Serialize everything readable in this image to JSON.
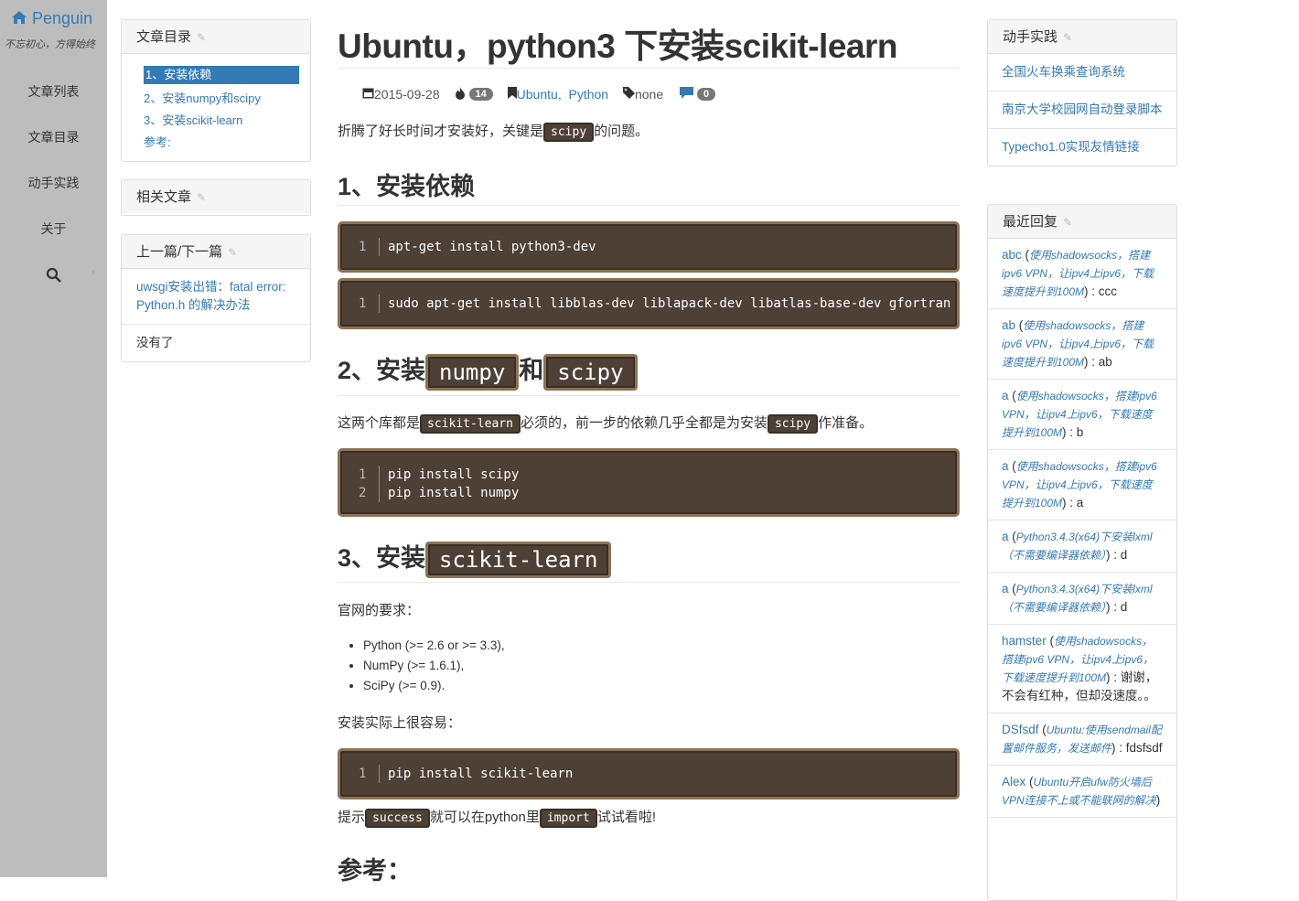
{
  "nav": {
    "brand": "Penguin",
    "motto": "不忘初心，方得始终",
    "items": [
      "文章列表",
      "文章目录",
      "动手实践",
      "关于"
    ]
  },
  "toc_panel": {
    "title": "文章目录",
    "items": [
      "1、安装依赖",
      "2、安装numpy和scipy",
      "3、安装scikit-learn",
      "参考:"
    ]
  },
  "related_panel": {
    "title": "相关文章"
  },
  "prevnext_panel": {
    "title": "上一篇/下一篇",
    "prev": "uwsgi安装出错：fatal error: Python.h 的解决办法",
    "next": "没有了"
  },
  "article": {
    "title": "Ubuntu，python3 下安装scikit-learn",
    "date": "2015-09-28",
    "views": "14",
    "categories": [
      "Ubuntu",
      "Python"
    ],
    "tags": "none",
    "comments": "0",
    "intro_before": "折腾了好长时间才安装好，关键是",
    "intro_code": "scipy",
    "intro_after": "的问题。",
    "h1": "1、安装依赖",
    "code1": [
      {
        "n": "1",
        "t": "apt-get install python3-dev"
      }
    ],
    "code2": [
      {
        "n": "1",
        "t": "sudo apt-get install libblas-dev liblapack-dev libatlas-base-dev gfortran"
      }
    ],
    "h2_prefix": "2、安装",
    "h2_code1": "numpy",
    "h2_mid": "和",
    "h2_code2": "scipy",
    "p2_a": "这两个库都是",
    "p2_code1": "scikit-learn",
    "p2_b": "必须的，前一步的依赖几乎全都是为安装",
    "p2_code2": "scipy",
    "p2_c": "作准备。",
    "code3": [
      {
        "n": "1",
        "t": "pip install scipy"
      },
      {
        "n": "2",
        "t": "pip install numpy"
      }
    ],
    "h3_prefix": "3、安装",
    "h3_code": "scikit-learn",
    "p3": "官网的要求：",
    "requirements": [
      "Python (>= 2.6 or >= 3.3),",
      "NumPy (>= 1.6.1),",
      "SciPy (>= 0.9)."
    ],
    "p4": "安装实际上很容易：",
    "code4": [
      {
        "n": "1",
        "t": "pip install scikit-learn"
      }
    ],
    "p5_a": "提示",
    "p5_code1": "success",
    "p5_b": "就可以在python里",
    "p5_code2": "import",
    "p5_c": "试试看啦!",
    "h4": "参考："
  },
  "practice_panel": {
    "title": "动手实践",
    "items": [
      "全国火车换乘查询系统",
      "南京大学校园网自动登录脚本",
      "Typecho1.0实现友情链接"
    ]
  },
  "replies_panel": {
    "title": "最近回复",
    "items": [
      {
        "who": "abc",
        "src": "使用shadowsocks，搭建ipv6 VPN，让ipv4上ipv6，下载速度提升到100M",
        "text": "ccc"
      },
      {
        "who": "ab",
        "src": "使用shadowsocks，搭建ipv6 VPN，让ipv4上ipv6，下载速度提升到100M",
        "text": "ab"
      },
      {
        "who": "a",
        "src": "使用shadowsocks，搭建ipv6 VPN，让ipv4上ipv6，下载速度提升到100M",
        "text": "b"
      },
      {
        "who": "a",
        "src": "使用shadowsocks，搭建ipv6 VPN，让ipv4上ipv6，下载速度提升到100M",
        "text": "a"
      },
      {
        "who": "a",
        "src": "Python3.4.3(x64)下安装lxml（不需要编译器依赖）",
        "text": "d"
      },
      {
        "who": "a",
        "src": "Python3.4.3(x64)下安装lxml（不需要编译器依赖）",
        "text": "d"
      },
      {
        "who": "hamster",
        "src": "使用shadowsocks，搭建ipv6 VPN，让ipv4上ipv6，下载速度提升到100M",
        "text": "谢谢，不会有红种，但却没速度。。"
      },
      {
        "who": "DSfsdf",
        "src": "Ubuntu:使用sendmail配置邮件服务，发送邮件",
        "text": "fdsfsdf"
      },
      {
        "who": "Alex",
        "src": "Ubuntu开启ufw防火墙后VPN连接不上或不能联网的解决",
        "text": ""
      }
    ]
  },
  "colors": {
    "accent": "#337ab7",
    "sidebar": "#bdbdbd",
    "code_bg": "#4e4035",
    "code_border": "#8b7355"
  }
}
